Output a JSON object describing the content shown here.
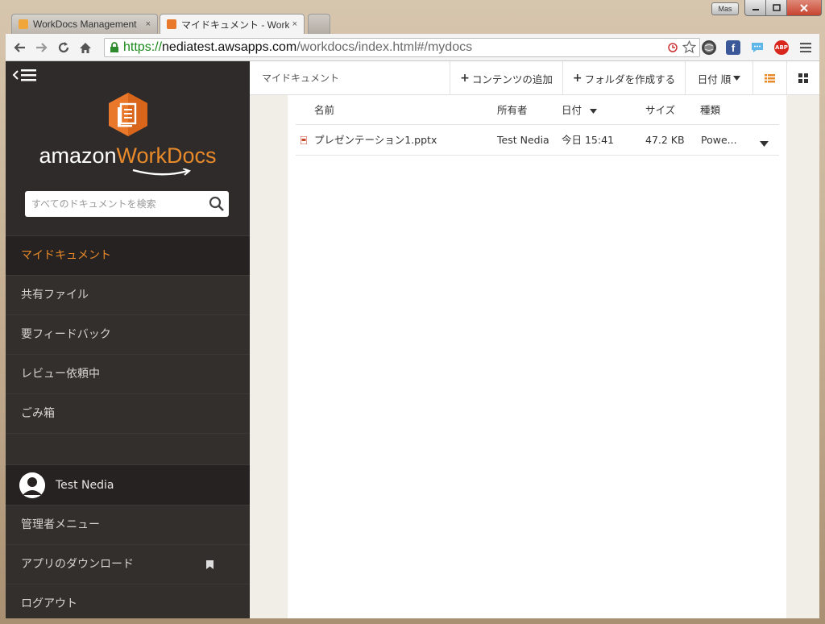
{
  "browser": {
    "tabs": [
      {
        "label": "WorkDocs Management",
        "close": "×"
      },
      {
        "label": "マイドキュメント - WorkDocs",
        "close": "×"
      }
    ],
    "user_badge": "Mas",
    "url": {
      "scheme": "https://",
      "host": "nediatest.awsapps.com",
      "path": "/workdocs/index.html#/mydocs"
    },
    "extensions": {
      "abp": "ABP",
      "facebook": "f"
    },
    "window_controls": {
      "min": "▭",
      "max": "□",
      "close": "✕"
    }
  },
  "sidebar": {
    "brand_amazon": "amazon",
    "brand_workdocs": "WorkDocs",
    "search_placeholder": "すべてのドキュメントを検索",
    "items": [
      {
        "label": "マイドキュメント",
        "active": true
      },
      {
        "label": "共有ファイル"
      },
      {
        "label": "要フィードバック"
      },
      {
        "label": "レビュー依頼中"
      },
      {
        "label": "ごみ箱"
      }
    ],
    "user_name": "Test Nedia",
    "bottom_items": [
      {
        "label": "管理者メニュー"
      },
      {
        "label": "アプリのダウンロード"
      },
      {
        "label": "ログアウト"
      }
    ]
  },
  "main": {
    "breadcrumb": "マイドキュメント",
    "add_content": "コンテンツの追加",
    "create_folder": "フォルダを作成する",
    "sort": "日付 順",
    "columns": {
      "name": "名前",
      "owner": "所有者",
      "date": "日付",
      "size": "サイズ",
      "type": "種類"
    },
    "files": [
      {
        "name": "プレゼンテーション1.pptx",
        "owner": "Test Nedia",
        "date": "今日 15:41",
        "size": "47.2 KB",
        "type": "Powe..."
      }
    ]
  },
  "colors": {
    "accent": "#e98a2a",
    "sidebar_bg": "#2f2b2a",
    "sidebar_active_bg": "#262221",
    "url_green": "#1a8a1a"
  }
}
